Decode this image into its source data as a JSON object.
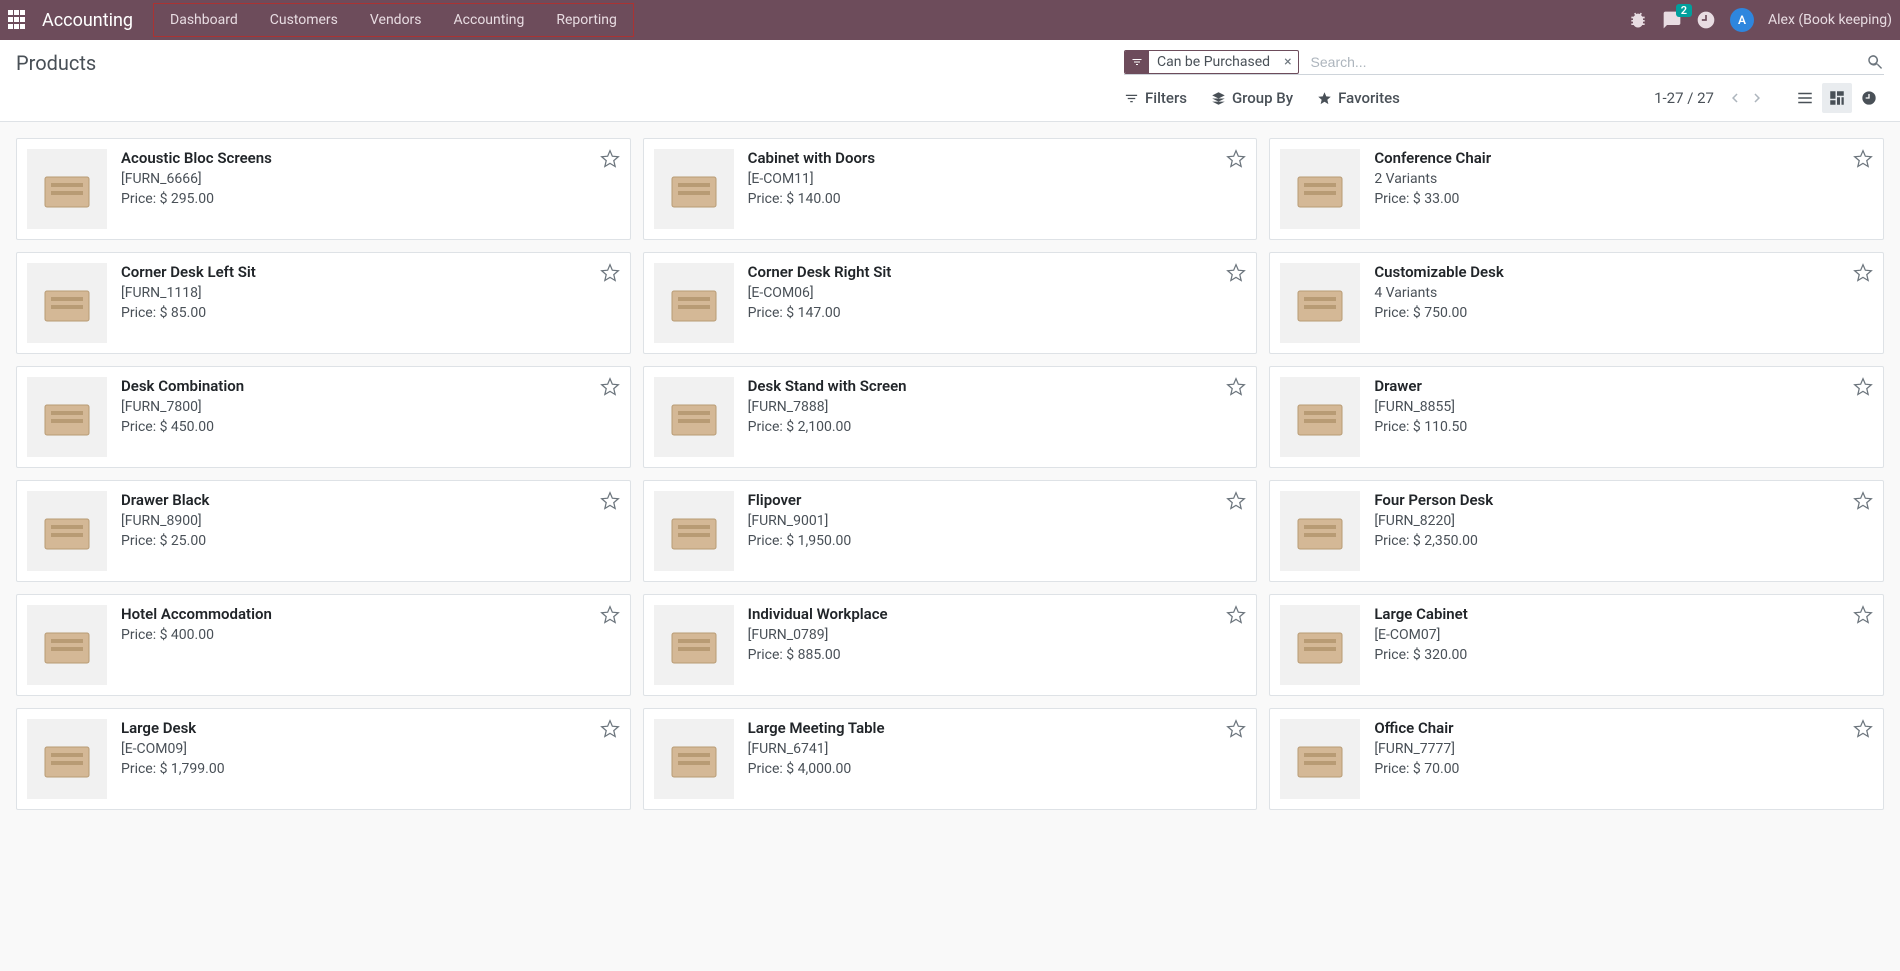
{
  "nav": {
    "brand": "Accounting",
    "menu": [
      "Dashboard",
      "Customers",
      "Vendors",
      "Accounting",
      "Reporting"
    ],
    "messages_badge": "2",
    "user_initial": "A",
    "user_name": "Alex (Book keeping)"
  },
  "control": {
    "title": "Products",
    "facet_label": "Can be Purchased",
    "search_placeholder": "Search...",
    "filters": "Filters",
    "groupby": "Group By",
    "favorites": "Favorites",
    "pager": "1-27 / 27"
  },
  "products": [
    {
      "name": "Acoustic Bloc Screens",
      "ref": "[FURN_6666]",
      "price": "Price: $ 295.00"
    },
    {
      "name": "Cabinet with Doors",
      "ref": "[E-COM11]",
      "price": "Price: $ 140.00"
    },
    {
      "name": "Conference Chair",
      "ref": "2 Variants",
      "price": "Price: $ 33.00"
    },
    {
      "name": "Corner Desk Left Sit",
      "ref": "[FURN_1118]",
      "price": "Price: $ 85.00"
    },
    {
      "name": "Corner Desk Right Sit",
      "ref": "[E-COM06]",
      "price": "Price: $ 147.00"
    },
    {
      "name": "Customizable Desk",
      "ref": "4 Variants",
      "price": "Price: $ 750.00"
    },
    {
      "name": "Desk Combination",
      "ref": "[FURN_7800]",
      "price": "Price: $ 450.00"
    },
    {
      "name": "Desk Stand with Screen",
      "ref": "[FURN_7888]",
      "price": "Price: $ 2,100.00"
    },
    {
      "name": "Drawer",
      "ref": "[FURN_8855]",
      "price": "Price: $ 110.50"
    },
    {
      "name": "Drawer Black",
      "ref": "[FURN_8900]",
      "price": "Price: $ 25.00"
    },
    {
      "name": "Flipover",
      "ref": "[FURN_9001]",
      "price": "Price: $ 1,950.00"
    },
    {
      "name": "Four Person Desk",
      "ref": "[FURN_8220]",
      "price": "Price: $ 2,350.00"
    },
    {
      "name": "Hotel Accommodation",
      "ref": "",
      "price": "Price: $ 400.00"
    },
    {
      "name": "Individual Workplace",
      "ref": "[FURN_0789]",
      "price": "Price: $ 885.00"
    },
    {
      "name": "Large Cabinet",
      "ref": "[E-COM07]",
      "price": "Price: $ 320.00"
    },
    {
      "name": "Large Desk",
      "ref": "[E-COM09]",
      "price": "Price: $ 1,799.00"
    },
    {
      "name": "Large Meeting Table",
      "ref": "[FURN_6741]",
      "price": "Price: $ 4,000.00"
    },
    {
      "name": "Office Chair",
      "ref": "[FURN_7777]",
      "price": "Price: $ 70.00"
    }
  ]
}
